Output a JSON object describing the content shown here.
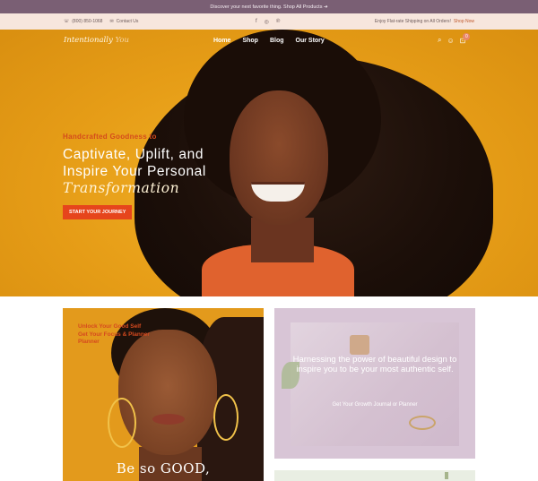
{
  "announcement": {
    "text": "Discover your next favorite thing. Shop All Products ➔"
  },
  "utility": {
    "phone": "(800) 850-1068",
    "contact": "Contact Us",
    "shipping_text": "Enjoy Flat-rate Shipping on All Orders!",
    "shipping_link": "Shop Now",
    "social_icons": [
      "facebook-icon",
      "instagram-icon",
      "pinterest-icon"
    ]
  },
  "header": {
    "logo": "Intentionally",
    "logo_accent": "You",
    "menu": [
      "Home",
      "Shop",
      "Blog",
      "Our Story"
    ],
    "cart_count": "0"
  },
  "hero": {
    "kicker": "Handcrafted Goodness to",
    "headline_1": "Captivate, Uplift, and",
    "headline_2": "Inspire Your Personal",
    "headline_script": "Transformation",
    "cta": "START YOUR JOURNEY"
  },
  "card_left": {
    "line1": "Unlock Your Good Self",
    "line2": "Get Your Focus & Planner",
    "line3": "Planner",
    "big_text": "Be so GOOD,"
  },
  "card_right": {
    "message": "Harnessing the power of beautiful design to inspire you to be your most authentic self.",
    "link": "Get Your Growth Journal or Planner"
  },
  "colors": {
    "accent": "#e6451c",
    "brand_purple": "#7a5f74",
    "hero_bg": "#e9a51c"
  }
}
